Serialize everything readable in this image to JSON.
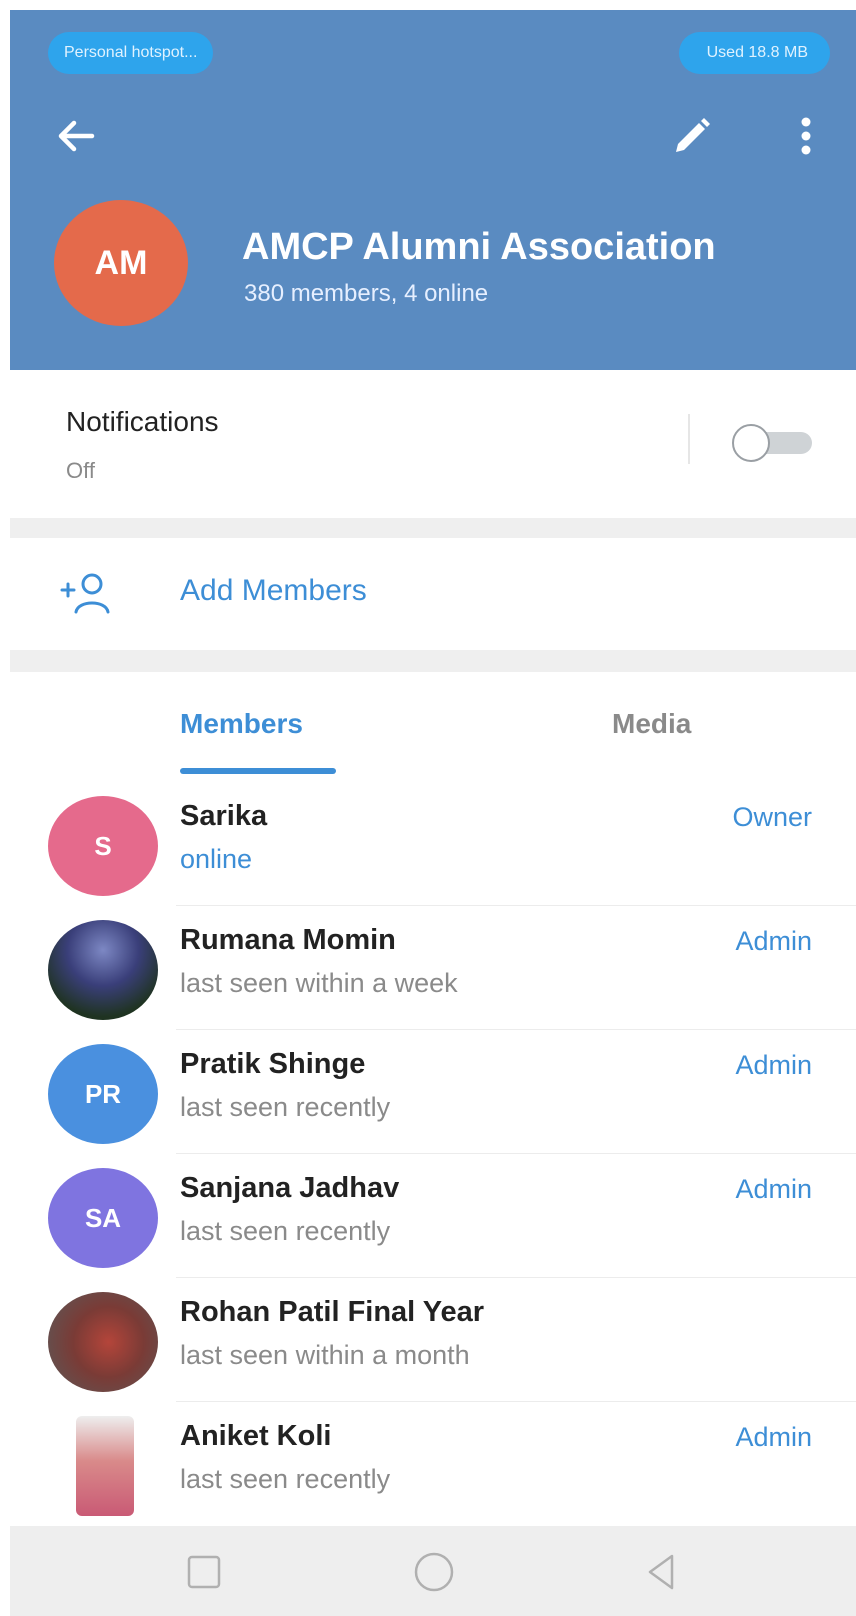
{
  "status_bar": {
    "hotspot": "Personal hotspot...",
    "data_used": "Used 18.8 MB"
  },
  "header": {
    "avatar_initials": "AM",
    "avatar_color": "#e46a4b",
    "title": "AMCP Alumni Association",
    "subtitle": "380 members, 4 online",
    "icons": [
      "back-arrow-icon",
      "edit-pencil-icon",
      "more-vertical-icon"
    ],
    "color": "#5a8bc1"
  },
  "notifications": {
    "title": "Notifications",
    "status": "Off"
  },
  "add_members": {
    "label": "Add Members"
  },
  "tabs": {
    "members": "Members",
    "media": "Media"
  },
  "members": [
    {
      "initials": "S",
      "name": "Sarika",
      "status": "online",
      "role": "Owner",
      "color": "#e56a8c"
    },
    {
      "initials": "",
      "name": "Rumana Momin",
      "status": "last seen within a week",
      "role": "Admin"
    },
    {
      "initials": "PR",
      "name": "Pratik Shinge",
      "status": "last seen recently",
      "role": "Admin",
      "color": "#4a90df"
    },
    {
      "initials": "SA",
      "name": "Sanjana Jadhav",
      "status": "last seen recently",
      "role": "Admin",
      "color": "#7f74e0"
    },
    {
      "initials": "",
      "name": "Rohan Patil Final Year",
      "status": "last seen within a month",
      "role": ""
    },
    {
      "initials": "",
      "name": "Aniket Koli",
      "status": "last seen recently",
      "role": "Admin"
    }
  ],
  "accent_color": "#3d8ed6"
}
